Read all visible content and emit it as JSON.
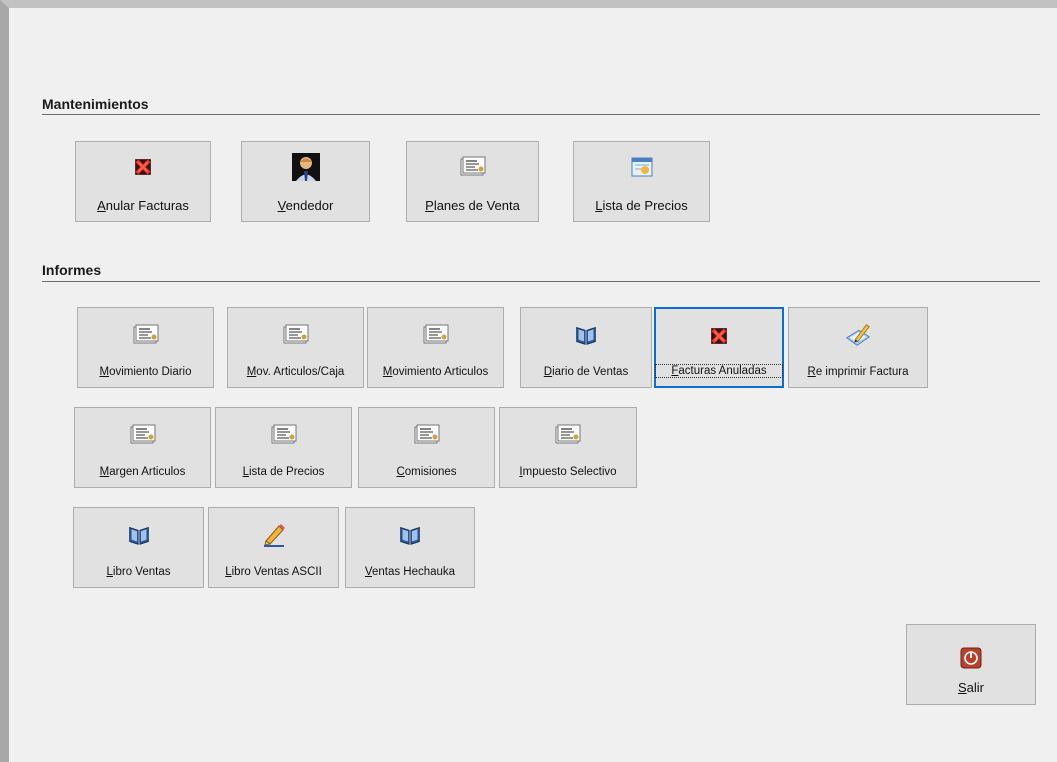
{
  "sections": {
    "mantenimientos": {
      "title": "Mantenimientos"
    },
    "informes": {
      "title": "Informes"
    }
  },
  "buttons": {
    "anular_facturas": {
      "mnemonic": "A",
      "rest": "nular Facturas",
      "icon": "red-x-icon"
    },
    "vendedor": {
      "mnemonic": "V",
      "rest": "endedor",
      "icon": "salesperson-icon"
    },
    "planes_venta": {
      "mnemonic": "P",
      "rest": "lanes de Venta",
      "icon": "report-icon"
    },
    "lista_precios_m": {
      "mnemonic": "L",
      "rest": "ista de Precios",
      "icon": "price-list-icon"
    },
    "movimiento_diario": {
      "mnemonic": "M",
      "rest": "ovimiento Diario",
      "icon": "report-icon"
    },
    "mov_articulos_caja": {
      "mnemonic": "M",
      "rest": "ov. Articulos/Caja",
      "icon": "report-icon"
    },
    "movimiento_articulos": {
      "mnemonic": "M",
      "rest": "ovimiento Articulos",
      "icon": "report-icon"
    },
    "diario_ventas": {
      "mnemonic": "D",
      "rest": "iario de Ventas",
      "icon": "book-icon"
    },
    "facturas_anuladas": {
      "mnemonic": "F",
      "rest": "acturas Anuladas",
      "icon": "red-x-icon"
    },
    "reimprimir_factura": {
      "mnemonic": "R",
      "rest": "e imprimir Factura",
      "icon": "edit-document-icon"
    },
    "margen_articulos": {
      "mnemonic": "M",
      "rest": "argen Articulos",
      "icon": "report-icon"
    },
    "lista_precios_i": {
      "mnemonic": "L",
      "rest": "ista de Precios",
      "icon": "report-icon"
    },
    "comisiones": {
      "mnemonic": "C",
      "rest": "omisiones",
      "icon": "report-icon"
    },
    "impuesto_selectivo": {
      "mnemonic": "I",
      "rest": "mpuesto Selectivo",
      "icon": "report-icon"
    },
    "libro_ventas": {
      "mnemonic": "L",
      "rest": "ibro Ventas",
      "icon": "book-icon"
    },
    "libro_ventas_ascii": {
      "mnemonic": "L",
      "rest": "ibro Ventas ASCII",
      "icon": "pencil-icon"
    },
    "ventas_hechauka": {
      "mnemonic": "V",
      "rest": "entas Hechauka",
      "icon": "book-icon"
    },
    "salir": {
      "mnemonic": "S",
      "rest": "alir",
      "icon": "power-icon"
    }
  },
  "colors": {
    "focus_border": "#0a6ed1",
    "button_bg": "#e1e1e1",
    "window_bg": "#f0f0f0"
  }
}
